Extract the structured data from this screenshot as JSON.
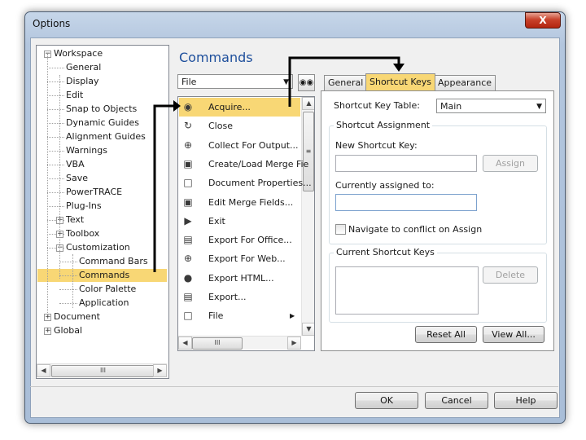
{
  "window": {
    "title": "Options",
    "close_label": "X"
  },
  "tree": {
    "items": [
      {
        "label": "Workspace"
      },
      {
        "label": "General"
      },
      {
        "label": "Display"
      },
      {
        "label": "Edit"
      },
      {
        "label": "Snap to Objects"
      },
      {
        "label": "Dynamic Guides"
      },
      {
        "label": "Alignment Guides"
      },
      {
        "label": "Warnings"
      },
      {
        "label": "VBA"
      },
      {
        "label": "Save"
      },
      {
        "label": "PowerTRACE"
      },
      {
        "label": "Plug-Ins"
      },
      {
        "label": "Text"
      },
      {
        "label": "Toolbox"
      },
      {
        "label": "Customization"
      },
      {
        "label": "Command Bars"
      },
      {
        "label": "Commands"
      },
      {
        "label": "Color Palette"
      },
      {
        "label": "Application"
      },
      {
        "label": "Document"
      },
      {
        "label": "Global"
      }
    ],
    "selected": "Commands",
    "scroll_thumb_glyph": "III"
  },
  "commands": {
    "heading": "Commands",
    "category_value": "File",
    "find_icon": "binoculars-icon",
    "items": [
      {
        "label": "Acquire..."
      },
      {
        "label": "Close"
      },
      {
        "label": "Collect For Output..."
      },
      {
        "label": "Create/Load Merge Fie"
      },
      {
        "label": "Document Properties..."
      },
      {
        "label": "Edit Merge Fields..."
      },
      {
        "label": "Exit"
      },
      {
        "label": "Export For Office..."
      },
      {
        "label": "Export For Web..."
      },
      {
        "label": "Export HTML..."
      },
      {
        "label": "Export..."
      },
      {
        "label": "File"
      }
    ],
    "selected": "Acquire...",
    "scroll_thumb_glyph": "III"
  },
  "tabs": {
    "general": "General",
    "shortcut_keys": "Shortcut Keys",
    "appearance": "Appearance"
  },
  "shortcut": {
    "table_label": "Shortcut Key Table:",
    "table_value": "Main",
    "assignment_group": "Shortcut Assignment",
    "new_key_label": "New Shortcut Key:",
    "new_key_value": "",
    "assign_button": "Assign",
    "assigned_label": "Currently assigned to:",
    "assigned_value": "",
    "navigate_checkbox": "Navigate to conflict on Assign",
    "navigate_checked": false,
    "current_group": "Current Shortcut Keys",
    "delete_button": "Delete",
    "reset_all_button": "Reset All",
    "view_all_button": "View All..."
  },
  "footer": {
    "ok": "OK",
    "cancel": "Cancel",
    "help": "Help"
  }
}
